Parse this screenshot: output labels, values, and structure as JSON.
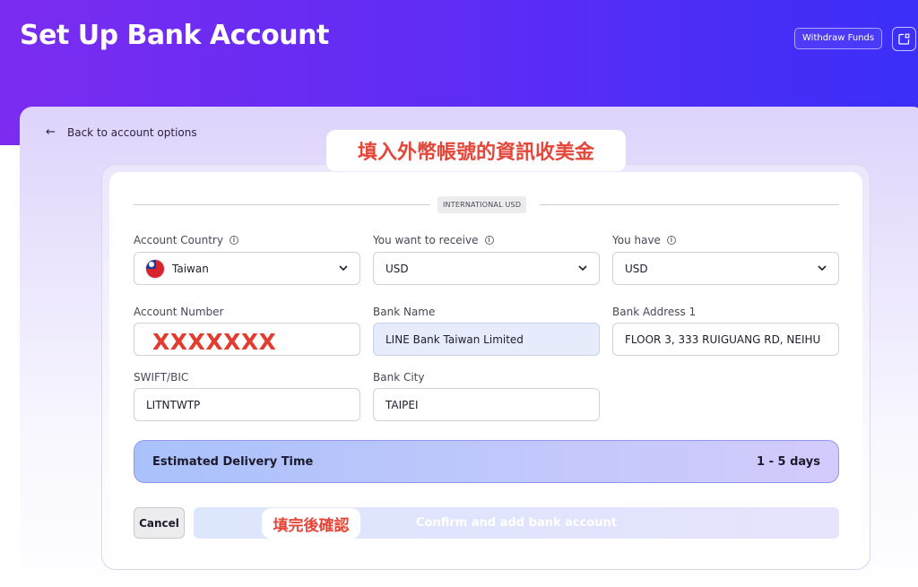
{
  "header": {
    "title": "Set Up Bank Account",
    "withdraw_label": "Withdraw Funds",
    "share_icon": "external-share-icon"
  },
  "back": {
    "label": "Back to account options",
    "icon": "arrow-left-icon"
  },
  "section_tag": "INTERNATIONAL USD",
  "form": {
    "account_country": {
      "label": "Account Country",
      "value": "Taiwan",
      "flag": "taiwan-flag-icon"
    },
    "receive": {
      "label": "You want to receive",
      "value": "USD"
    },
    "have": {
      "label": "You have",
      "value": "USD"
    },
    "account_number": {
      "label": "Account Number",
      "value": "XXXXXXX"
    },
    "bank_name": {
      "label": "Bank Name",
      "value": "LINE Bank Taiwan Limited"
    },
    "bank_address": {
      "label": "Bank Address 1",
      "value": "FLOOR 3, 333 RUIGUANG RD, NEIHU"
    },
    "swift": {
      "label": "SWIFT/BIC",
      "value": "LITNTWTP"
    },
    "bank_city": {
      "label": "Bank City",
      "value": "TAIPEI"
    }
  },
  "delivery": {
    "label": "Estimated Delivery Time",
    "value": "1 - 5 days"
  },
  "actions": {
    "cancel_label": "Cancel",
    "confirm_label": "Confirm and add bank account"
  },
  "annotations": {
    "top": "填入外幣帳號的資訊收美金",
    "bottom": "填完後確認"
  },
  "colors": {
    "header_start": "#7b2cf0",
    "header_end": "#3b2ff8",
    "annotation_red": "#e4463a",
    "delivery_border": "#8e98ec"
  }
}
